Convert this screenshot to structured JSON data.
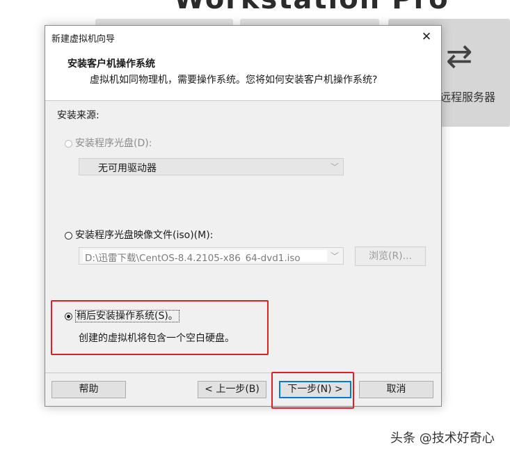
{
  "background": {
    "title_fragment": "Workstation Pro",
    "remote_label": "远程服务器",
    "remote_icon": "swap-arrows-icon",
    "watermark": "头条 @技术好奇心"
  },
  "dialog": {
    "title": "新建虚拟机向导",
    "close_icon": "close-icon",
    "header_title": "安装客户机操作系统",
    "header_subtitle": "虚拟机如同物理机，需要操作系统。您将如何安装客户机操作系统?",
    "source_label": "安装来源:",
    "options": [
      {
        "label": "安装程序光盘(D):",
        "selected": false,
        "enabled": false
      },
      {
        "label": "安装程序光盘映像文件(iso)(M):",
        "selected": false,
        "enabled": true
      },
      {
        "label": "稍后安装操作系统(S)。",
        "selected": true,
        "enabled": true
      }
    ],
    "disc_drive_value": "无可用驱动器",
    "iso_path_value": "D:\\迅雷下载\\CentOS-8.4.2105-x86_64-dvd1.iso",
    "browse_label": "浏览(R)...",
    "later_description": "创建的虚拟机将包含一个空白硬盘。",
    "buttons": {
      "help": "帮助",
      "back": "< 上一步(B)",
      "next": "下一步(N) >",
      "cancel": "取消"
    },
    "highlight_color": "#e02020",
    "accent_color": "#0078d7"
  }
}
